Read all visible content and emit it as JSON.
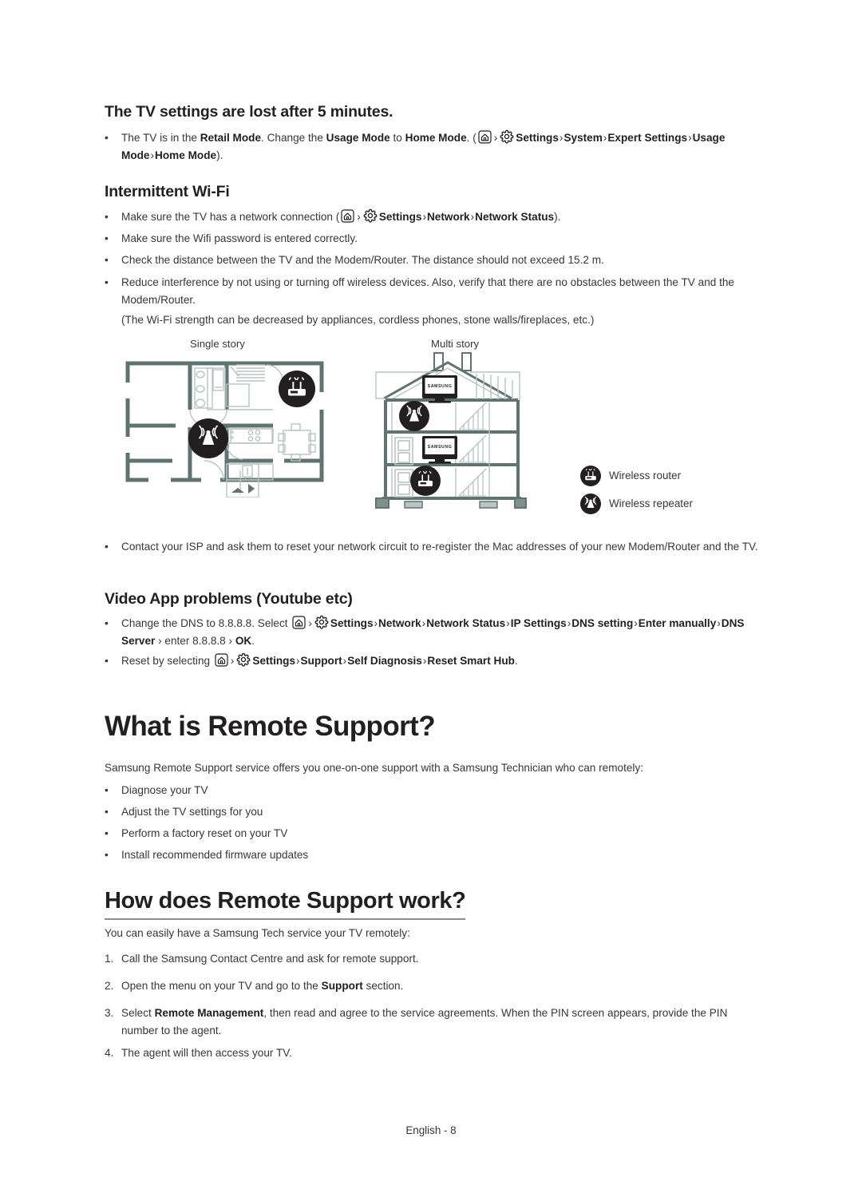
{
  "document": {
    "footer": "English - 8"
  },
  "sections": {
    "tv_settings_lost": {
      "heading": "The TV settings are lost after 5 minutes.",
      "bullet1": {
        "p1": "The TV is in the ",
        "b1": "Retail Mode",
        "p2": ". Change the ",
        "b2": "Usage Mode",
        "p3": " to ",
        "b3": "Home Mode",
        "p4": ". (",
        "home_icon": "home-icon",
        "arrow1": "›",
        "gear_icon": "gear-icon",
        "b4": "Settings",
        "arrow2": "›",
        "b5": "System",
        "arrow3": "›",
        "b6": "Expert Settings",
        "arrow4": "›",
        "b7": "Usage Mode",
        "arrow5": "›",
        "b8": "Home Mode",
        "p5": ")."
      }
    },
    "intermittent_wifi": {
      "heading": "Intermittent Wi-Fi",
      "bullet1": {
        "p1": "Make sure the TV has a network connection (",
        "arrow1": "›",
        "b1": "Settings",
        "arrow2": "›",
        "b2": "Network",
        "arrow3": "›",
        "b3": "Network Status",
        "p2": ")."
      },
      "bullet2": "Make sure the Wifi password is entered correctly.",
      "bullet3": "Check the distance between the TV and the Modem/Router. The distance should not exceed 15.2 m.",
      "bullet4": "Reduce interference by not using or turning off wireless devices. Also, verify that there are no obstacles between the TV and the Modem/Router.",
      "note": "(The Wi-Fi strength can be decreased by appliances, cordless phones, stone walls/fireplaces, etc.)",
      "bullet5": "Contact your ISP and ask them to reset your network circuit to re-register the Mac addresses of your new Modem/Router and the TV."
    },
    "diagram": {
      "label_single": "Single story",
      "label_multi": "Multi story",
      "legend": [
        {
          "icon": "wireless-router-icon",
          "label": "Wireless router"
        },
        {
          "icon": "wireless-repeater-icon",
          "label": "Wireless repeater"
        }
      ],
      "tv_brand": "SAMSUNG"
    },
    "video_app": {
      "heading": "Video App problems (Youtube etc)",
      "bullet1": {
        "p1": "Change the DNS to 8.8.8.8. Select ",
        "arrow1": "›",
        "b1": "Settings",
        "arrow2": "›",
        "b2": "Network",
        "arrow3": "›",
        "b3": "Network Status",
        "arrow4": "›",
        "b4": "IP Settings",
        "arrow5": "›",
        "b5": "DNS setting",
        "arrow6": "›",
        "b6": "Enter manually",
        "arrow7": "›",
        "b7": "DNS Server",
        "p2": " › enter 8.8.8.8 › ",
        "b8": "OK",
        "p3": "."
      },
      "bullet2": {
        "p1": "Reset by selecting ",
        "arrow1": "›",
        "b1": "Settings",
        "arrow2": "›",
        "b2": "Support",
        "arrow3": "›",
        "b3": "Self Diagnosis",
        "arrow4": "›",
        "b4": "Reset Smart Hub",
        "p2": "."
      }
    },
    "what_is_remote_support": {
      "heading": "What is Remote Support?",
      "intro": "Samsung Remote Support service offers you one-on-one support with a Samsung Technician who can remotely:",
      "bullets": [
        "Diagnose your TV",
        "Adjust the TV settings for you",
        "Perform a factory reset on your TV",
        "Install recommended firmware updates"
      ]
    },
    "how_does_it_work": {
      "heading": "How does Remote Support work?",
      "intro": "You can easily have a Samsung Tech service your TV remotely:",
      "steps": [
        {
          "num": "1.",
          "text": "Call the Samsung Contact Centre and ask for remote support."
        },
        {
          "num": "2.",
          "p1": "Open the menu on your TV and go to the ",
          "b1": "Support",
          "p2": " section."
        },
        {
          "num": "3.",
          "p1": "Select ",
          "b1": "Remote Management",
          "p2": ", then read and agree to the service agreements. When the PIN screen appears, provide the PIN number to the agent."
        },
        {
          "num": "4.",
          "text": "The agent will then access your TV."
        }
      ]
    }
  },
  "markers": {
    "bullet": "•"
  },
  "colors": {
    "text": "#3a3539",
    "heading": "#231f20",
    "wall": "#5f7470",
    "badge": "#231f20"
  }
}
